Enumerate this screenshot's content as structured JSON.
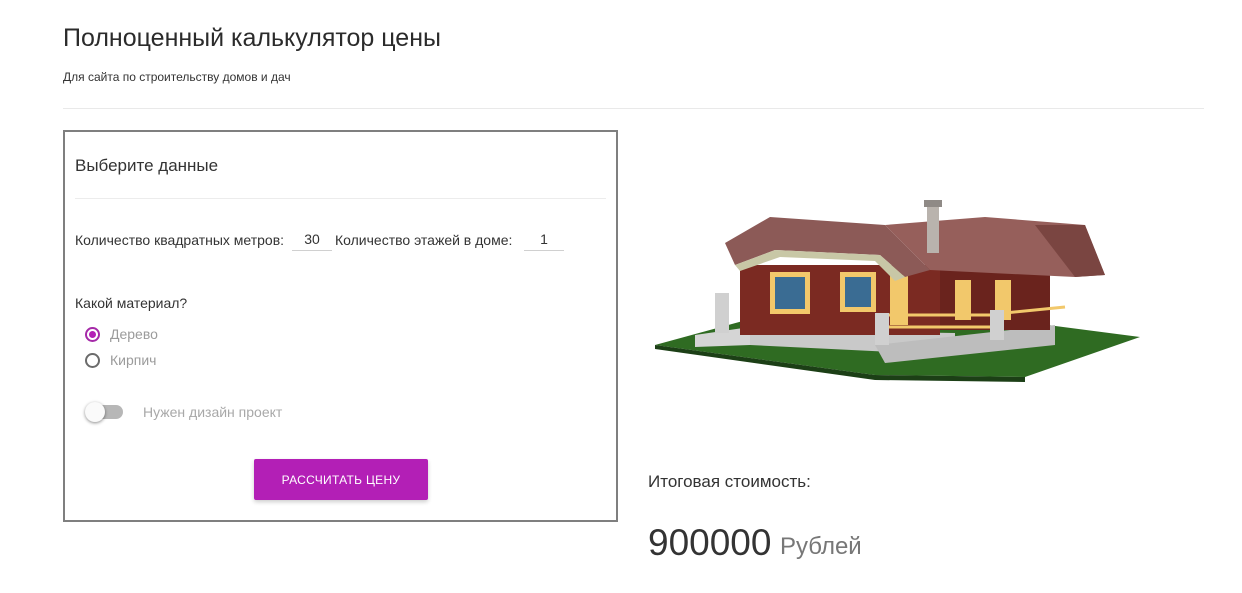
{
  "header": {
    "title": "Полноценный калькулятор цены",
    "subtitle": "Для сайта по строительству домов и дач"
  },
  "form": {
    "title": "Выберите данные",
    "area_label": "Количество квадратных метров:",
    "area_value": "30",
    "floors_label": "Количество этажей в доме:",
    "floors_value": "1",
    "material_question": "Какой материал?",
    "materials": [
      {
        "label": "Дерево",
        "checked": true
      },
      {
        "label": "Кирпич",
        "checked": false
      }
    ],
    "design_toggle_label": "Нужен дизайн проект",
    "design_toggle_on": false,
    "calculate_button": "РАССЧИТАТЬ ЦЕНУ"
  },
  "result": {
    "label": "Итоговая стоимость:",
    "value": "900000",
    "currency": "Рублей"
  },
  "colors": {
    "accent": "#b31fb6",
    "card_border": "#7f7f7f"
  }
}
